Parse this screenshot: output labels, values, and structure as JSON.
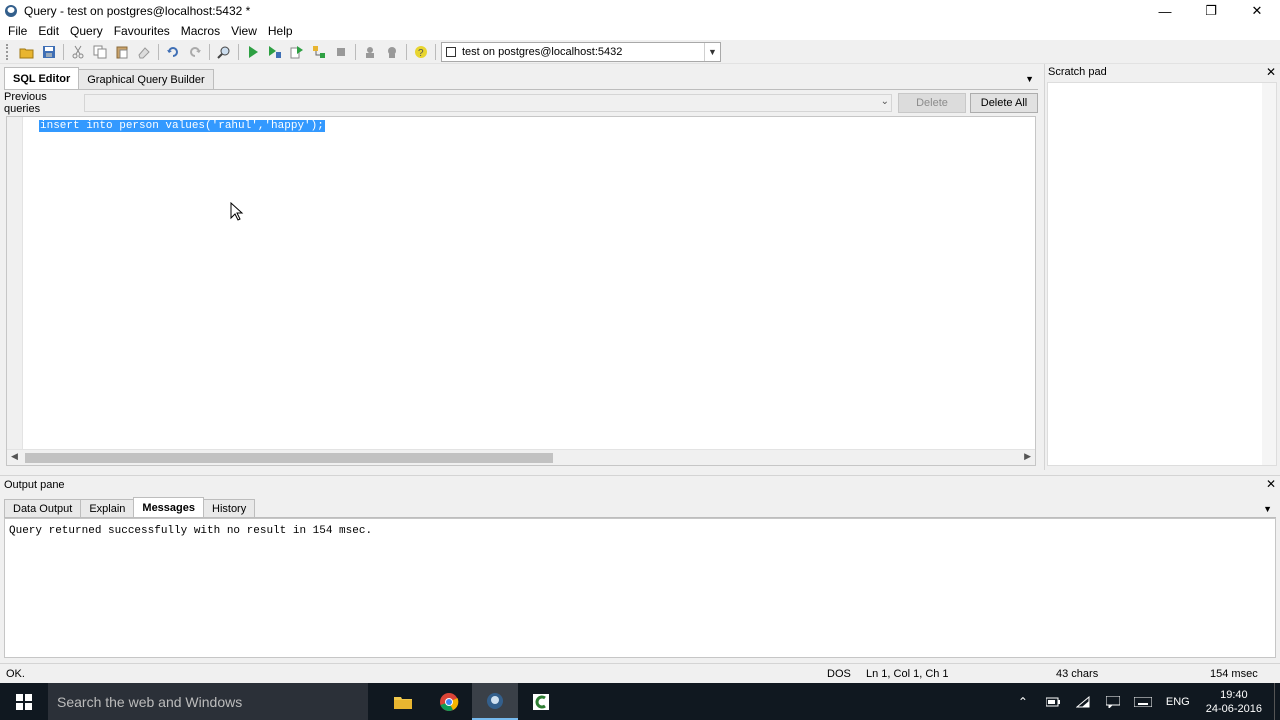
{
  "window": {
    "title": "Query - test on postgres@localhost:5432 *",
    "controls": {
      "minimize": "—",
      "maximize": "❐",
      "close": "✕"
    }
  },
  "menu": {
    "items": [
      "File",
      "Edit",
      "Query",
      "Favourites",
      "Macros",
      "View",
      "Help"
    ]
  },
  "toolbar": {
    "connection": "test on postgres@localhost:5432",
    "icons": [
      "open-file-icon",
      "save-icon",
      "cut-icon",
      "copy-icon",
      "paste-icon",
      "clear-icon",
      "undo-icon",
      "redo-icon",
      "find-icon",
      "execute-icon",
      "execute-pgscript-icon",
      "execute-to-file-icon",
      "explain-icon",
      "cancel-icon",
      "explain-analyze-icon",
      "vacuum-icon",
      "help-icon"
    ]
  },
  "editor": {
    "tabs": [
      {
        "label": "SQL Editor",
        "active": true
      },
      {
        "label": "Graphical Query Builder",
        "active": false
      }
    ],
    "previous_queries_label": "Previous queries",
    "delete_label": "Delete",
    "delete_all_label": "Delete All",
    "sql": "insert into person values('rahul','happy');"
  },
  "scratch_pad": {
    "title": "Scratch pad"
  },
  "output": {
    "title": "Output pane",
    "tabs": [
      {
        "label": "Data Output",
        "active": false
      },
      {
        "label": "Explain",
        "active": false
      },
      {
        "label": "Messages",
        "active": true
      },
      {
        "label": "History",
        "active": false
      }
    ],
    "message": "Query returned successfully with no result in 154 msec."
  },
  "status": {
    "state": "OK.",
    "line_ending": "DOS",
    "position": "Ln 1, Col 1, Ch 1",
    "chars": "43 chars",
    "time": "154 msec"
  },
  "taskbar": {
    "search_placeholder": "Search the web and Windows",
    "language": "ENG",
    "time": "19:40",
    "date": "24-06-2016"
  },
  "colors": {
    "selection": "#3399ff",
    "taskbar": "#101820",
    "accent": "#76b9ed"
  }
}
